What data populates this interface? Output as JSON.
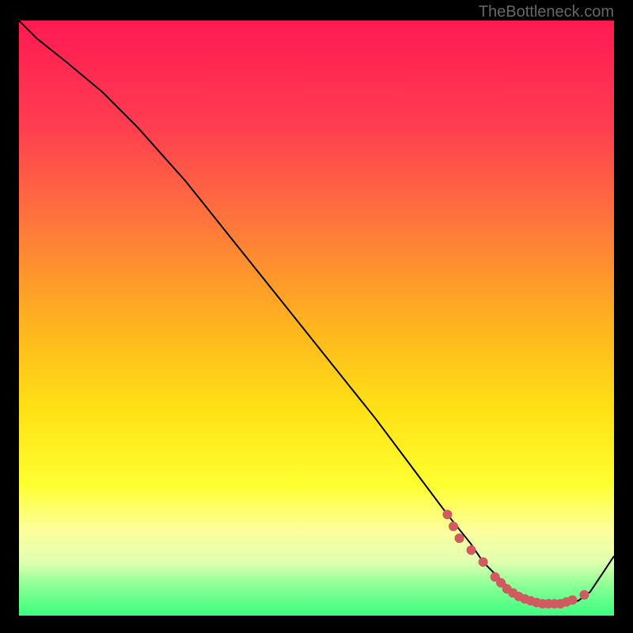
{
  "watermark": "TheBottleneck.com",
  "chart_data": {
    "type": "line",
    "title": "",
    "xlabel": "",
    "ylabel": "",
    "xlim": [
      0,
      100
    ],
    "ylim": [
      0,
      100
    ],
    "series": [
      {
        "name": "curve",
        "x": [
          0,
          3,
          8,
          14,
          20,
          28,
          36,
          44,
          52,
          60,
          66,
          72,
          76,
          78,
          80,
          82,
          84,
          86,
          88,
          90,
          92,
          94,
          96,
          98,
          100
        ],
        "y": [
          100,
          97,
          93,
          88,
          82,
          73,
          63,
          53,
          43,
          33,
          25,
          17,
          12,
          9,
          7,
          5,
          3.5,
          2.5,
          2,
          2,
          2,
          2.5,
          4,
          7,
          10
        ],
        "color": "#000000"
      }
    ],
    "markers": {
      "x": [
        72,
        73,
        74,
        76,
        78,
        80,
        81,
        82,
        83,
        84,
        85,
        86,
        87,
        88,
        89,
        90,
        91,
        92,
        93,
        95
      ],
      "y": [
        17,
        15,
        13,
        11,
        9,
        6.5,
        5.5,
        4.5,
        3.8,
        3.2,
        2.8,
        2.5,
        2.2,
        2,
        2,
        2,
        2,
        2.3,
        2.6,
        3.5
      ],
      "color": "#d15a60",
      "size": 6
    }
  }
}
